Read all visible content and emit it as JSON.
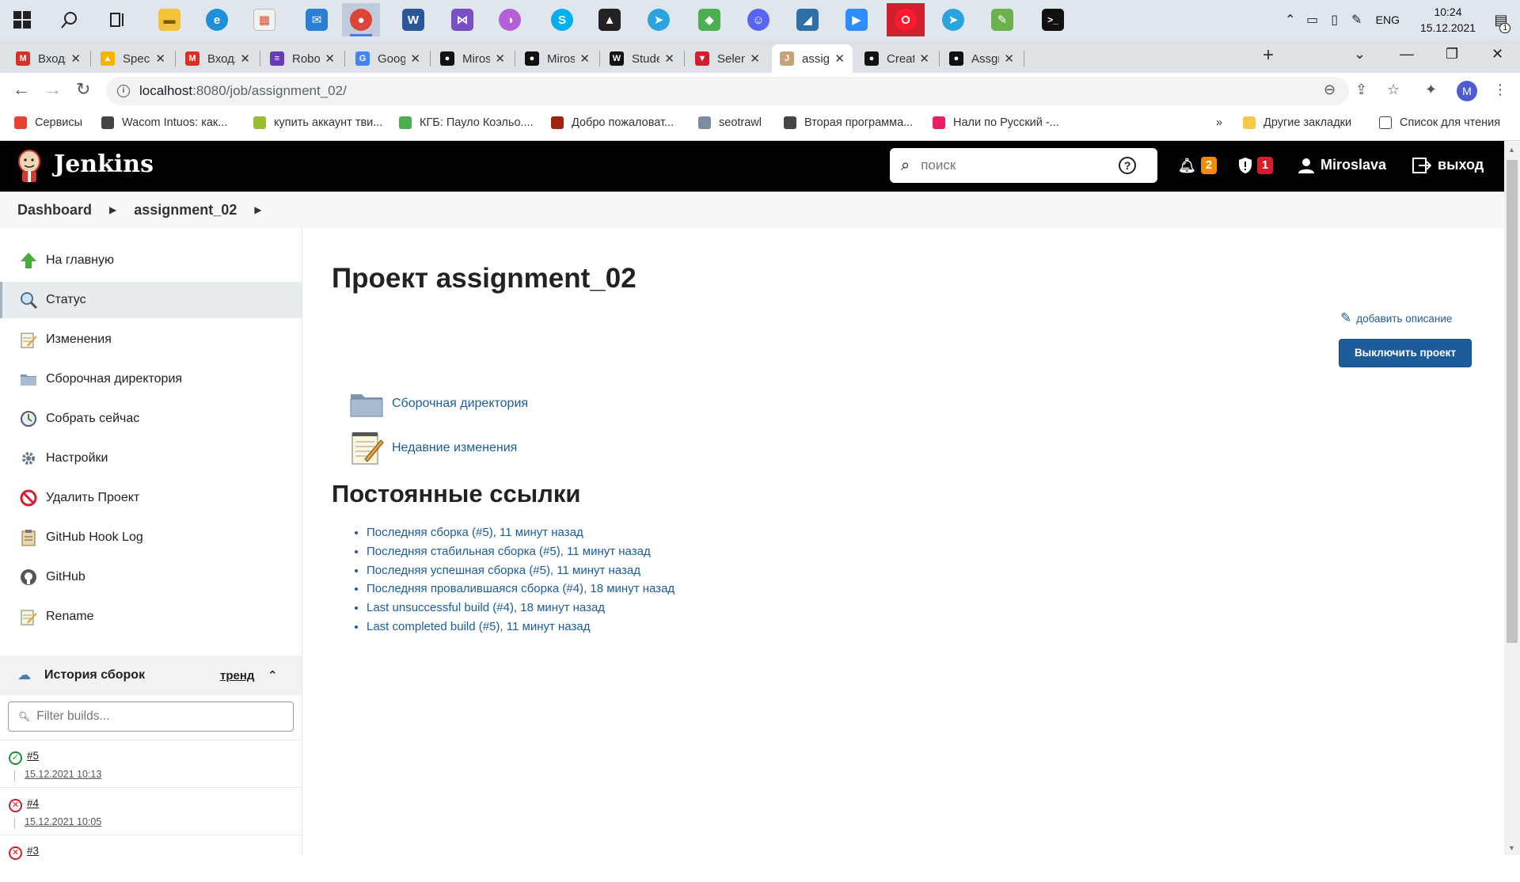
{
  "taskbar": {
    "apps": [
      "start-icon",
      "search-icon",
      "task-view-icon",
      "file-explorer-icon",
      "edge-icon",
      "store-icon",
      "mail-icon",
      "chrome-icon",
      "word-icon",
      "visual-studio-icon",
      "app-icon",
      "skype-icon",
      "inkscape-icon",
      "telegram-icon",
      "photo-app-icon",
      "discord-icon",
      "mysql-workbench-icon",
      "zoom-icon",
      "opera-icon",
      "telegram-alt-icon",
      "notepad-icon",
      "terminal-icon"
    ],
    "lang": "ENG",
    "time": "10:24",
    "date": "15.12.2021",
    "notifications": "1"
  },
  "tabs": [
    {
      "title": "Входящ",
      "icon": "gmail-icon",
      "color": "#d93025",
      "glyph": "M"
    },
    {
      "title": "Specific",
      "icon": "google-drive-icon",
      "color": "#f4b400",
      "glyph": "▲"
    },
    {
      "title": "Входящ",
      "icon": "gmail-icon",
      "color": "#d93025",
      "glyph": "M"
    },
    {
      "title": "Robots",
      "icon": "document-icon",
      "color": "#673ab7",
      "glyph": "≡"
    },
    {
      "title": "Google",
      "icon": "translate-icon",
      "color": "#4285f4",
      "glyph": "G"
    },
    {
      "title": "Miroslа",
      "icon": "github-icon",
      "color": "#111",
      "glyph": "●"
    },
    {
      "title": "Miroslа",
      "icon": "github-icon",
      "color": "#111",
      "glyph": "●"
    },
    {
      "title": "Student",
      "icon": "student-icon",
      "color": "#111",
      "glyph": "W"
    },
    {
      "title": "Seleniu",
      "icon": "selenium-icon",
      "color": "#d21f2e",
      "glyph": "▼"
    },
    {
      "title": "assignm",
      "icon": "jenkins-icon",
      "color": "#c6a27a",
      "glyph": "J"
    },
    {
      "title": "Creatin",
      "icon": "github-icon",
      "color": "#111",
      "glyph": "●"
    },
    {
      "title": "Assgm",
      "icon": "github-icon",
      "color": "#111",
      "glyph": "●"
    }
  ],
  "address": {
    "host": "localhost",
    "path": ":8080/job/assignment_02/"
  },
  "bookmarks": [
    {
      "label": "Сервисы",
      "color": "#e94235"
    },
    {
      "label": "Wacom Intuos: как...",
      "color": "#444"
    },
    {
      "label": "купить аккаунт тви...",
      "color": "#9abd2f"
    },
    {
      "label": "КГБ: Пауло Коэльо....",
      "color": "#4caf50"
    },
    {
      "label": "Добро пожаловат...",
      "color": "#a1220f"
    },
    {
      "label": "seotrawl",
      "color": "#7a8ea0"
    },
    {
      "label": "Вторая программа...",
      "color": "#444"
    },
    {
      "label": "Нали по Русский -...",
      "color": "#e91e63"
    }
  ],
  "bookmarks_more": "»",
  "other_bookmarks": "Другие закладки",
  "reading_list": "Список для чтения",
  "jenkins": {
    "title": "Jenkins",
    "search_placeholder": "поиск",
    "notifications_count": "2",
    "security_count": "1",
    "user": "Miroslava",
    "logout": "выход",
    "badge_orange": "#f08c00",
    "badge_red": "#d21f2e"
  },
  "breadcrumb": {
    "items": [
      "Dashboard",
      "assignment_02"
    ]
  },
  "side": {
    "tasks": [
      {
        "label": "На главную",
        "icon": "up-arrow-icon"
      },
      {
        "label": "Статус",
        "icon": "magnifier-icon"
      },
      {
        "label": "Изменения",
        "icon": "notepad-icon"
      },
      {
        "label": "Сборочная директория",
        "icon": "folder-icon"
      },
      {
        "label": "Собрать сейчас",
        "icon": "clock-icon"
      },
      {
        "label": "Настройки",
        "icon": "gear-icon"
      },
      {
        "label": "Удалить Проект",
        "icon": "no-entry-icon"
      },
      {
        "label": "GitHub Hook Log",
        "icon": "clipboard-icon"
      },
      {
        "label": "GitHub",
        "icon": "github-icon"
      },
      {
        "label": "Rename",
        "icon": "notepad-icon"
      }
    ],
    "history_title": "История сборок",
    "trend": "тренд",
    "filter_placeholder": "Filter builds...",
    "builds": [
      {
        "number": "#5",
        "date": "15.12.2021 10:13",
        "status": "success"
      },
      {
        "number": "#4",
        "date": "15.12.2021 10:05",
        "status": "failed"
      },
      {
        "number": "#3",
        "date": "",
        "status": "failed"
      }
    ]
  },
  "main": {
    "title": "Проект assignment_02",
    "add_description": "добавить описание",
    "disable_button": "Выключить проект",
    "links": [
      {
        "label": "Сборочная директория",
        "icon": "folder-icon"
      },
      {
        "label": "Недавние изменения",
        "icon": "notepad-icon"
      }
    ],
    "permalinks_title": "Постоянные ссылки",
    "permalinks": [
      "Последняя сборка (#5), 11 минут назад",
      "Последняя стабильная сборка (#5), 11 минут назад",
      "Последняя успешная сборка (#5), 11 минут назад",
      "Последняя провалившаяся сборка (#4), 18 минут назад",
      "Last unsuccessful build (#4), 18 минут назад",
      "Last completed build (#5), 11 минут назад"
    ]
  }
}
